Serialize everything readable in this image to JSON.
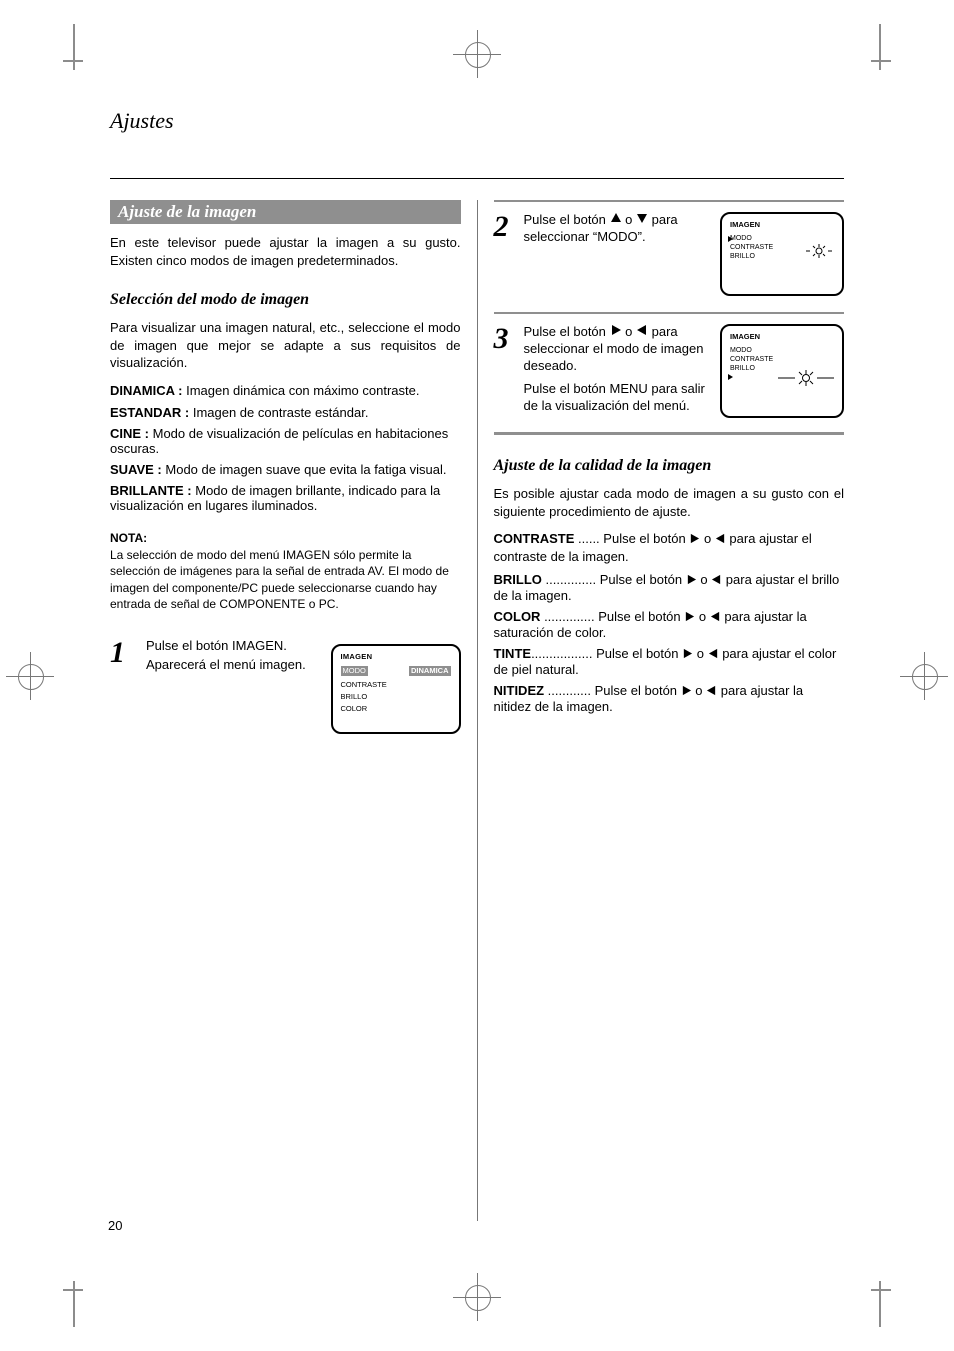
{
  "chapter_title": "Ajustes",
  "section_bar_title": "Ajuste de la imagen",
  "intro": "En este televisor puede ajustar la imagen a su gusto. Existen cinco modos de imagen predeterminados.",
  "subhead_mode": "Selección del modo de imagen",
  "mode_pre": "Para visualizar una imagen natural, etc., seleccione el modo de imagen que mejor se adapte a sus requisitos de visualización.",
  "modes": {
    "DINAMICA": {
      "label": "DINAMICA :",
      "desc": "Imagen dinámica con máximo contraste."
    },
    "ESTANDAR": {
      "label": "ESTANDAR :",
      "desc": "Imagen de contraste estándar."
    },
    "CINE": {
      "label": "CINE :",
      "desc": "Modo de visualización de películas en habitaciones oscuras."
    },
    "SUAVE": {
      "label": "SUAVE :",
      "desc": "Modo de imagen suave que evita la fatiga visual."
    },
    "BRILLANTE": {
      "label": "BRILLANTE :",
      "desc": "Modo de imagen brillante, indicado para la visualización en lugares iluminados."
    }
  },
  "note1_label": "NOTA:",
  "note1_body": "La selección de modo del menú IMAGEN sólo permite la selección de imágenes para la señal de entrada AV. El modo de imagen del componente/PC puede seleccionarse cuando hay entrada de señal de COMPONENTE o PC.",
  "step1": {
    "text": "Pulse el botón IMAGEN.",
    "follow": "Aparecerá el menú imagen."
  },
  "osd1": {
    "line1": "IMAGEN",
    "modo": "MODO",
    "modo_val": "DINAMICA",
    "contraste": "CONTRASTE",
    "brillo": "BRILLO",
    "color": "COLOR"
  },
  "right": {
    "step2": {
      "num": "2",
      "pre": "Pulse el botón",
      "mid": "o",
      "post": "para seleccionar “MODO”."
    },
    "step3": {
      "num": "3",
      "pre1": "Pulse el botón",
      "mid1": "o",
      "post1": "para seleccionar el modo de imagen dese­ado.",
      "pre2": "Pulse el botón MENU para salir de la visualización del menú."
    },
    "subhead_adj": "Ajuste de la calidad de la imagen",
    "adj_intro": "Es posible ajustar cada modo de imagen a su gusto con el siguiente procedimiento de ajuste.",
    "items": {
      "contraste": {
        "label": "CONTRASTE ",
        "pad": "...... ",
        "pre": "Pulse el botón ",
        "mid": " o ",
        "post": " para ajustar el contraste de la imagen."
      },
      "brillo": {
        "label": "BRILLO ",
        "pad": ".............. ",
        "pre": "Pulse el botón ",
        "mid": " o ",
        "post": " para ajustar el brillo de la imagen."
      },
      "color": {
        "label": "COLOR ",
        "pad": ".............. ",
        "pre": "Pulse el botón ",
        "mid": " o ",
        "post": " para ajustar la saturación de color."
      },
      "tinte": {
        "label": "TINTE",
        "pad": "................. ",
        "pre": "Pulse el botón ",
        "mid": " o ",
        "post": " para ajustar el color de piel natural."
      },
      "nitidez": {
        "label": "NITIDEZ ",
        "pad": "............ ",
        "pre": "Pulse el botón ",
        "mid": " o ",
        "post": " para ajustar la nitidez de la imagen."
      }
    },
    "mini_osd": {
      "ttl": "IMAGEN",
      "lab1": "MODO",
      "lab2": "CONTRASTE",
      "lab3": "BRILLO"
    }
  },
  "page_number": "20"
}
